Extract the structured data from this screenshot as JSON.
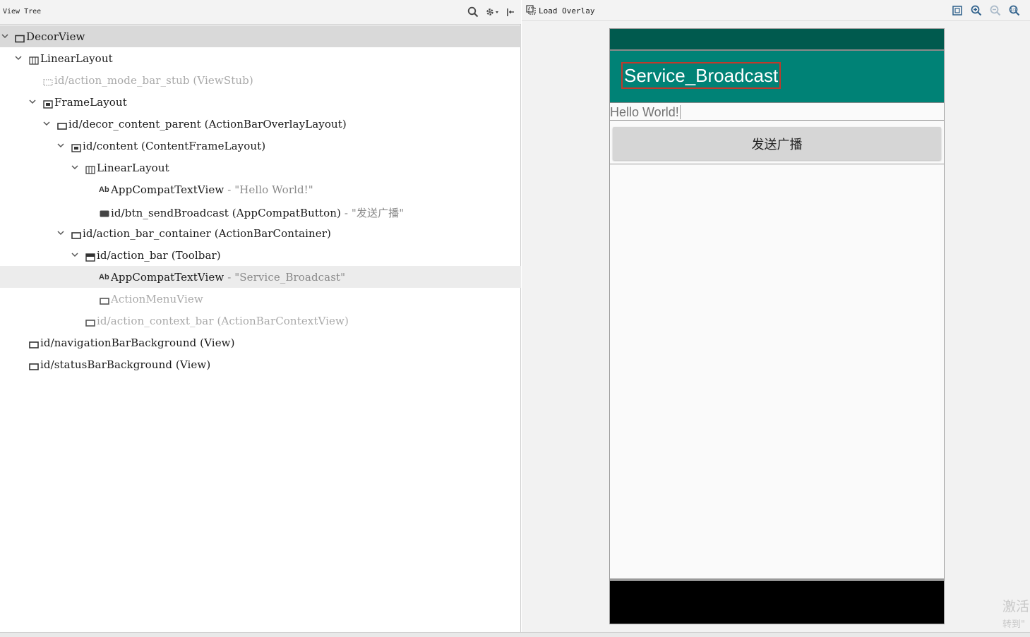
{
  "tree_panel": {
    "title": "View Tree",
    "icons": [
      "search-icon",
      "gear-icon",
      "pin-icon"
    ],
    "nodes": [
      {
        "label": "DecorView",
        "extra": "",
        "icon": "frame-icon",
        "expanded": true,
        "dim": false,
        "selected": true
      },
      {
        "label": "LinearLayout",
        "extra": "",
        "icon": "linear-layout-icon",
        "expanded": true,
        "dim": false
      },
      {
        "label": "id/action_mode_bar_stub (ViewStub)",
        "extra": "",
        "icon": "viewstub-icon",
        "dim": true
      },
      {
        "label": "FrameLayout",
        "extra": "",
        "icon": "framelayout-icon",
        "expanded": true,
        "dim": false
      },
      {
        "label": "id/decor_content_parent (ActionBarOverlayLayout)",
        "extra": "",
        "icon": "view-icon",
        "expanded": true,
        "dim": false
      },
      {
        "label": "id/content (ContentFrameLayout)",
        "extra": "",
        "icon": "framelayout-icon",
        "expanded": true,
        "dim": false
      },
      {
        "label": "LinearLayout",
        "extra": "",
        "icon": "linear-layout-icon",
        "expanded": true,
        "dim": false
      },
      {
        "label": "AppCompatTextView",
        "extra": " - \"Hello World!\"",
        "icon": "textview-icon",
        "dim": false
      },
      {
        "label": "id/btn_sendBroadcast (AppCompatButton)",
        "extra": " - \"发送广播\"",
        "icon": "button-icon",
        "dim": false
      },
      {
        "label": "id/action_bar_container (ActionBarContainer)",
        "extra": "",
        "icon": "view-icon",
        "expanded": true,
        "dim": false
      },
      {
        "label": "id/action_bar (Toolbar)",
        "extra": "",
        "icon": "toolbar-icon",
        "expanded": true,
        "dim": false
      },
      {
        "label": "AppCompatTextView",
        "extra": " - \"Service_Broadcast\"",
        "icon": "textview-icon",
        "dim": false,
        "hover": true
      },
      {
        "label": "ActionMenuView",
        "extra": "",
        "icon": "view-icon",
        "dim": true
      },
      {
        "label": "id/action_context_bar (ActionBarContextView)",
        "extra": "",
        "icon": "view-icon",
        "dim": true
      },
      {
        "label": "id/navigationBarBackground (View)",
        "extra": "",
        "icon": "view-icon",
        "dim": false
      },
      {
        "label": "id/statusBarBackground (View)",
        "extra": "",
        "icon": "view-icon",
        "dim": false
      }
    ],
    "textview_icon_text": "Ab"
  },
  "preview_panel": {
    "load_overlay_label": "Load Overlay",
    "zoom_icons": [
      "fit-screen-icon",
      "zoom-in-icon",
      "zoom-out-icon",
      "zoom-actual-icon"
    ],
    "device": {
      "toolbar_title": "Service_Broadcast",
      "hello_text": "Hello World!",
      "button_label": "发送广播"
    },
    "colors": {
      "status_bar": "#005a4e",
      "toolbar": "#008276",
      "selection_outline": "#c0392b",
      "nav_bar": "#000000"
    }
  },
  "watermark": {
    "line1": "激活",
    "line2": "转到\""
  }
}
